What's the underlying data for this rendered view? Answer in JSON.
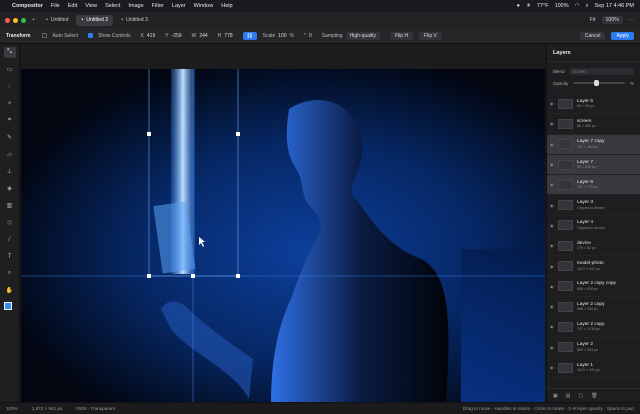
{
  "menubar": {
    "app": "Compositor",
    "items": [
      "File",
      "Edit",
      "View",
      "Select",
      "Image",
      "Filter",
      "Layer",
      "Window",
      "Help"
    ],
    "weather": "77°F",
    "clock": "Sep 17  4:46 PM",
    "battery": "100%"
  },
  "tabs": [
    {
      "label": "Untitled",
      "active": false
    },
    {
      "label": "Untitled 2",
      "active": true
    },
    {
      "label": "Untitled 3",
      "active": false
    }
  ],
  "tabbar_right": {
    "fit": "Fit",
    "zoom": "100%"
  },
  "options": {
    "tool": "Transform",
    "auto_select": "Auto Select",
    "show_controls": "Show Controls",
    "x_label": "X",
    "x": "419",
    "y_label": "Y",
    "y": "-259",
    "w_label": "W",
    "w": "244",
    "h_label": "H",
    "h": "778",
    "scale_label": "Scale",
    "scale": "100",
    "pct": "%",
    "rot_label": "°",
    "rot": "0",
    "sampling_label": "Sampling",
    "sampling": "High-quality",
    "flip_h": "Flip H",
    "flip_v": "Flip V",
    "cancel": "Cancel",
    "apply": "Apply"
  },
  "panel": {
    "title": "Layers",
    "blend_label": "Blend",
    "blend_value": "Screen",
    "opacity_label": "Opacity",
    "opacity_pct": "%"
  },
  "layers": [
    {
      "name": "Layer 5",
      "sub": "66 × 58 px",
      "selected": false
    },
    {
      "name": "screen",
      "sub": "66 × 350 px",
      "selected": false
    },
    {
      "name": "Layer 7 copy",
      "sub": "167 × 364 px",
      "selected": true
    },
    {
      "name": "Layer 7",
      "sub": "56 × 596 px",
      "selected": true
    },
    {
      "name": "Layer 6",
      "sub": "227 × 779 px",
      "selected": true
    },
    {
      "name": "Layer 3",
      "sub": "Clipped to device",
      "selected": false
    },
    {
      "name": "Layer 4",
      "sub": "Clipped to device",
      "selected": false
    },
    {
      "name": "device",
      "sub": "175 × 82 px",
      "selected": false
    },
    {
      "name": "model-photo",
      "sub": "1672 × 941 px",
      "selected": false
    },
    {
      "name": "Layer 2 copy copy",
      "sub": "866 × 938 px",
      "selected": false
    },
    {
      "name": "Layer 2 copy",
      "sub": "866 × 938 px",
      "selected": false
    },
    {
      "name": "Layer 2 copy",
      "sub": "767 × 1018 px",
      "selected": false
    },
    {
      "name": "Layer 2",
      "sub": "869 × 833 px",
      "selected": false
    },
    {
      "name": "Layer 1",
      "sub": "1672 × 941 px",
      "selected": false
    }
  ],
  "status": {
    "zoom": "100%",
    "size": "1,672 × 941 px",
    "color": "#608 · Transparent",
    "hint": "Drag to move · Handles to resize · Circle to rotate · 1–9 layer opacity · Space to pan"
  }
}
